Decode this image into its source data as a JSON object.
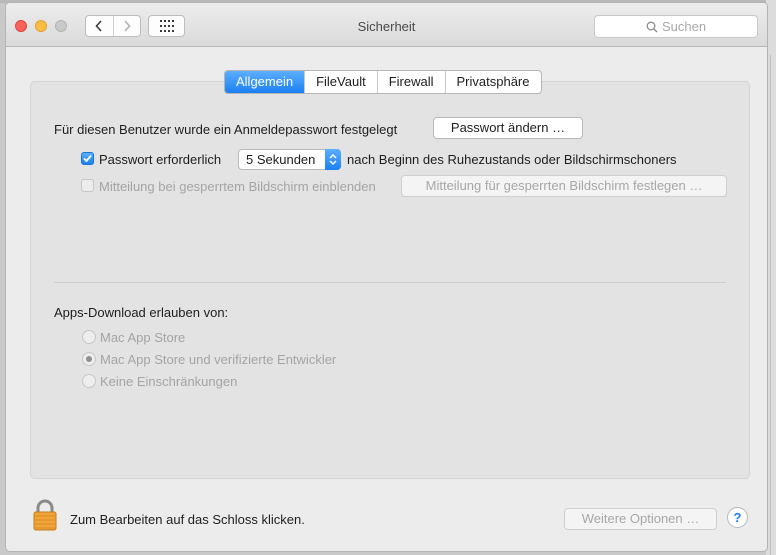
{
  "window": {
    "title": "Sicherheit",
    "search_placeholder": "Suchen"
  },
  "tabs": [
    {
      "label": "Allgemein",
      "active": true
    },
    {
      "label": "FileVault",
      "active": false
    },
    {
      "label": "Firewall",
      "active": false
    },
    {
      "label": "Privatsphäre",
      "active": false
    }
  ],
  "general": {
    "password_set_text": "Für diesen Benutzer wurde ein Anmeldepasswort festgelegt",
    "change_password_button": "Passwort ändern …",
    "require_password_checkbox": {
      "label": "Passwort erforderlich",
      "checked": true
    },
    "require_password_delay": "5 Sekunden",
    "require_password_suffix": "nach Beginn des Ruhezustands oder Bildschirmschoners",
    "lock_message_checkbox": {
      "label": "Mitteilung bei gesperrtem Bildschirm einblenden",
      "checked": false,
      "enabled": false
    },
    "lock_message_button": "Mitteilung für gesperrten Bildschirm festlegen …"
  },
  "downloads": {
    "heading": "Apps-Download erlauben von:",
    "options": [
      {
        "label": "Mac App Store",
        "selected": false
      },
      {
        "label": "Mac App Store und verifizierte Entwickler",
        "selected": true
      },
      {
        "label": "Keine Einschränkungen",
        "selected": false
      }
    ]
  },
  "footer": {
    "lock_text": "Zum Bearbeiten auf das Schloss klicken.",
    "advanced_button": "Weitere Optionen …",
    "help_label": "?"
  },
  "icons": {
    "back": "chevron-left-icon",
    "forward": "chevron-right-icon",
    "grid": "grid-icon",
    "search": "search-icon",
    "lock": "lock-icon",
    "popup_arrow": "updown-arrows-icon"
  },
  "colors": {
    "accent": "#1b80f2",
    "close": "#fc605b",
    "minimize": "#fdbc40",
    "lock": "#f0a43a"
  }
}
